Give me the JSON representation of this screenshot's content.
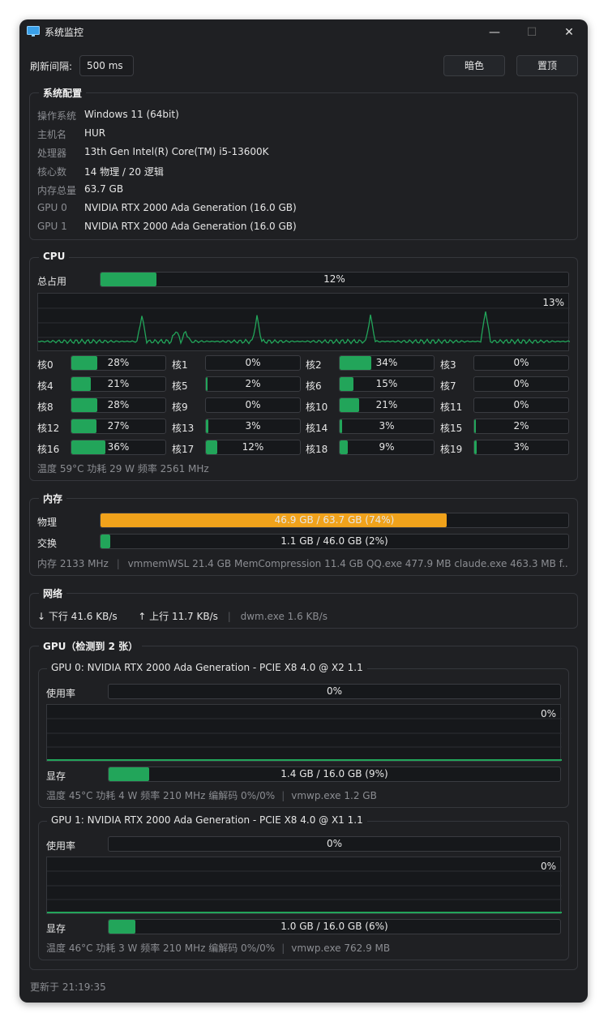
{
  "window": {
    "title": "系统监控",
    "min": "—",
    "max": "☐",
    "close": "✕"
  },
  "toolbar": {
    "refresh_label": "刷新间隔:",
    "refresh_value": "500 ms",
    "dark_button": "暗色",
    "top_button": "置顶"
  },
  "config": {
    "title": "系统配置",
    "rows": [
      {
        "key": "操作系统",
        "value": "Windows 11 (64bit)"
      },
      {
        "key": "主机名",
        "value": "HUR"
      },
      {
        "key": "处理器",
        "value": "13th Gen Intel(R) Core(TM) i5-13600K"
      },
      {
        "key": "核心数",
        "value": "14 物理 / 20 逻辑"
      },
      {
        "key": "内存总量",
        "value": "63.7 GB"
      },
      {
        "key": "GPU 0",
        "value": "NVIDIA RTX 2000 Ada Generation  (16.0 GB)"
      },
      {
        "key": "GPU 1",
        "value": "NVIDIA RTX 2000 Ada Generation  (16.0 GB)"
      }
    ]
  },
  "cpu": {
    "title": "CPU",
    "total_label": "总占用",
    "total_value": 12,
    "total_text": "12%",
    "chart_max_text": "13%",
    "cores": [
      {
        "label": "核0",
        "value": 28,
        "text": "28%"
      },
      {
        "label": "核1",
        "value": 0,
        "text": "0%"
      },
      {
        "label": "核2",
        "value": 34,
        "text": "34%"
      },
      {
        "label": "核3",
        "value": 0,
        "text": "0%"
      },
      {
        "label": "核4",
        "value": 21,
        "text": "21%"
      },
      {
        "label": "核5",
        "value": 2,
        "text": "2%"
      },
      {
        "label": "核6",
        "value": 15,
        "text": "15%"
      },
      {
        "label": "核7",
        "value": 0,
        "text": "0%"
      },
      {
        "label": "核8",
        "value": 28,
        "text": "28%"
      },
      {
        "label": "核9",
        "value": 0,
        "text": "0%"
      },
      {
        "label": "核10",
        "value": 21,
        "text": "21%"
      },
      {
        "label": "核11",
        "value": 0,
        "text": "0%"
      },
      {
        "label": "核12",
        "value": 27,
        "text": "27%"
      },
      {
        "label": "核13",
        "value": 3,
        "text": "3%"
      },
      {
        "label": "核14",
        "value": 3,
        "text": "3%"
      },
      {
        "label": "核15",
        "value": 2,
        "text": "2%"
      },
      {
        "label": "核16",
        "value": 36,
        "text": "36%"
      },
      {
        "label": "核17",
        "value": 12,
        "text": "12%"
      },
      {
        "label": "核18",
        "value": 9,
        "text": "9%"
      },
      {
        "label": "核19",
        "value": 3,
        "text": "3%"
      }
    ],
    "status": "温度 59°C    功耗 29 W    频率 2561 MHz"
  },
  "memory": {
    "title": "内存",
    "physical_label": "物理",
    "physical_value": 74,
    "physical_text": "46.9 GB / 63.7 GB  (74%)",
    "swap_label": "交换",
    "swap_value": 2,
    "swap_text": "1.1 GB / 46.0 GB  (2%)",
    "status_freq": "内存 2133 MHz",
    "status_sep": "|",
    "status_procs": "vmmemWSL 21.4 GB   MemCompression 11.4 GB   QQ.exe 477.9 MB   claude.exe 463.3 MB   f..."
  },
  "network": {
    "title": "网络",
    "down": "↓ 下行 41.6 KB/s",
    "up": "↑ 上行 11.7 KB/s",
    "sep": "|",
    "proc": "dwm.exe 1.6 KB/s"
  },
  "gpu": {
    "title": "GPU（检测到 2 张）",
    "cards": [
      {
        "title": "GPU 0: NVIDIA RTX 2000 Ada Generation - PCIE X8 4.0 @ X2 1.1",
        "usage_label": "使用率",
        "usage_value": 0,
        "usage_text": "0%",
        "chart_text": "0%",
        "vram_label": "显存",
        "vram_value": 9,
        "vram_text": "1.4 GB / 16.0 GB  (9%)",
        "status": "温度 45°C   功耗 4 W   频率 210 MHz   编解码 0%/0%",
        "sep": "|",
        "proc": "vmwp.exe 1.2 GB"
      },
      {
        "title": "GPU 1: NVIDIA RTX 2000 Ada Generation - PCIE X8 4.0 @ X1 1.1",
        "usage_label": "使用率",
        "usage_value": 0,
        "usage_text": "0%",
        "chart_text": "0%",
        "vram_label": "显存",
        "vram_value": 6,
        "vram_text": "1.0 GB / 16.0 GB  (6%)",
        "status": "温度 46°C   功耗 3 W   频率 210 MHz   编解码 0%/0%",
        "sep": "|",
        "proc": "vmwp.exe 762.9 MB"
      }
    ]
  },
  "footer": {
    "updated": "更新于 21:19:35"
  },
  "colors": {
    "accent_green": "#22a55a",
    "accent_orange": "#f0a21b",
    "background": "#1f2023"
  }
}
